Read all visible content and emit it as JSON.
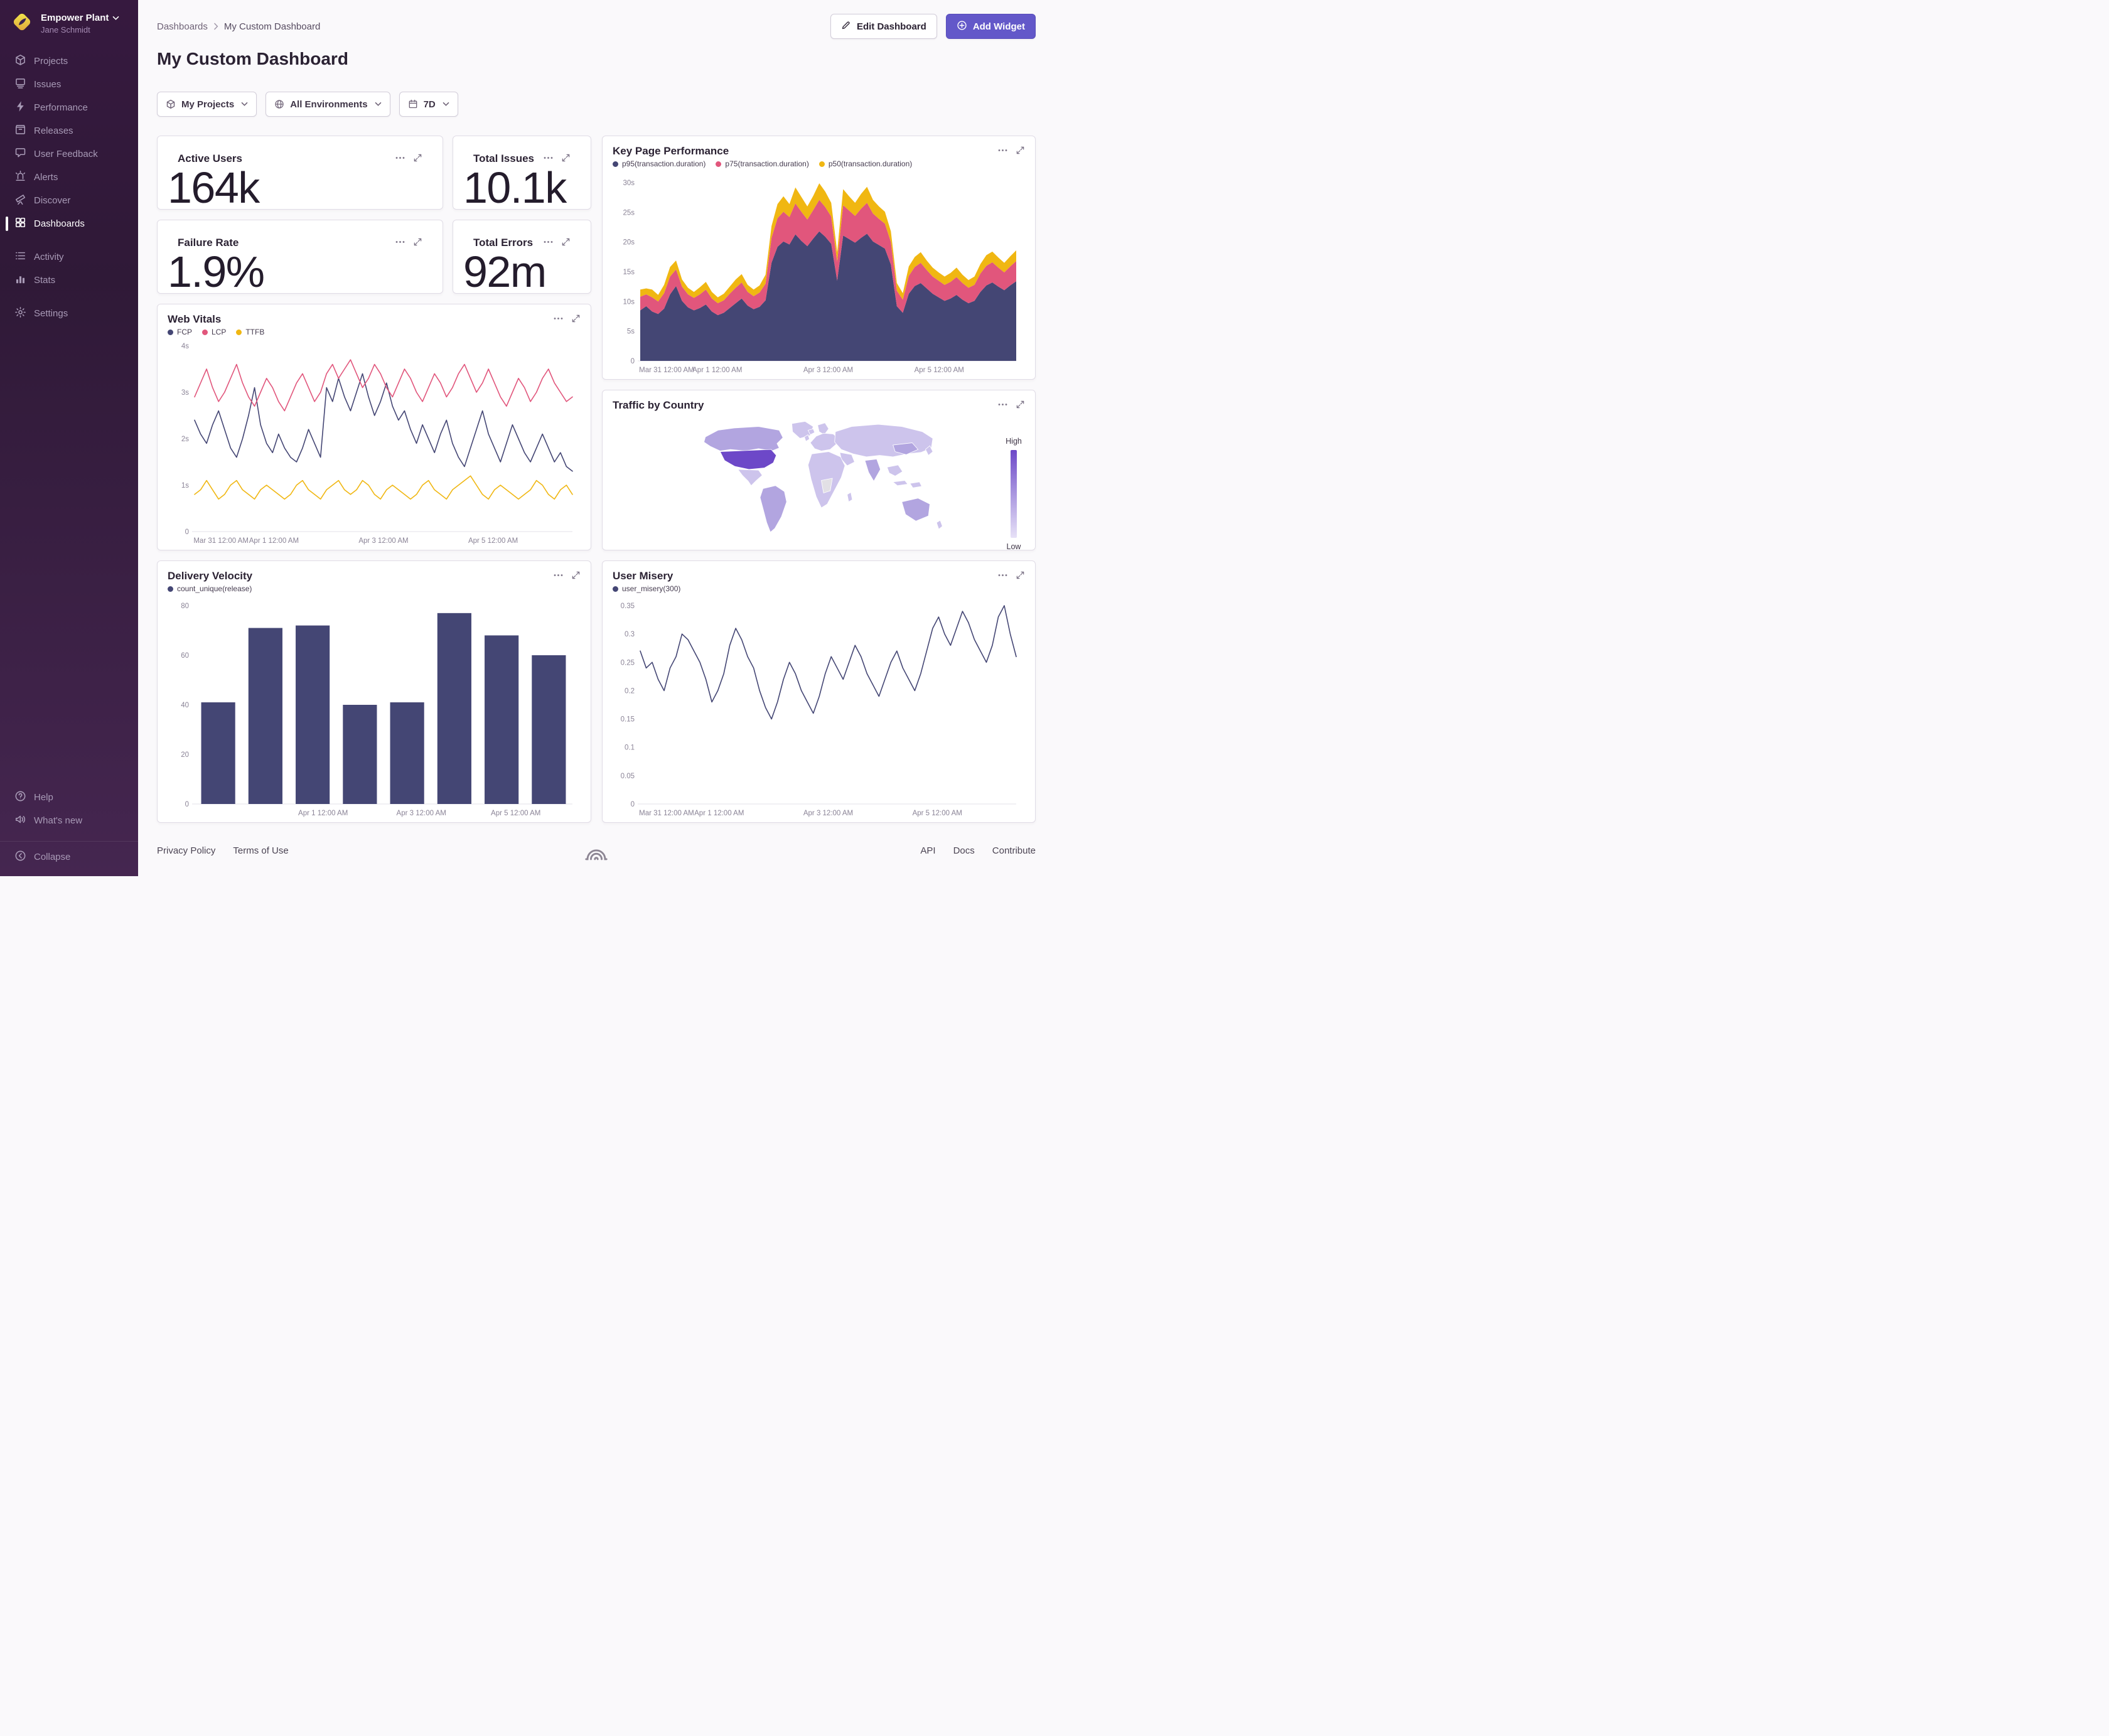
{
  "brand": {
    "accent_purple": "#6358C9",
    "sidebar_top": "#36193F",
    "sidebar_bottom": "#452650",
    "chart_navy": "#444674",
    "chart_pink": "#E1567C",
    "chart_yellow": "#F0B712",
    "map_high": "#6D48C8",
    "map_low": "#E7E1F7"
  },
  "sidebar": {
    "org_name": "Empower Plant",
    "user_name": "Jane Schmidt",
    "items": [
      {
        "label": "Projects"
      },
      {
        "label": "Issues"
      },
      {
        "label": "Performance"
      },
      {
        "label": "Releases"
      },
      {
        "label": "User Feedback"
      },
      {
        "label": "Alerts"
      },
      {
        "label": "Discover"
      },
      {
        "label": "Dashboards"
      },
      {
        "label": "Activity"
      },
      {
        "label": "Stats"
      },
      {
        "label": "Settings"
      }
    ],
    "footer_items": [
      {
        "label": "Help"
      },
      {
        "label": "What's new"
      },
      {
        "label": "Collapse"
      }
    ]
  },
  "breadcrumb": {
    "parent": "Dashboards",
    "current": "My Custom Dashboard"
  },
  "header": {
    "title": "My Custom Dashboard",
    "edit_button": "Edit Dashboard",
    "add_button": "Add Widget"
  },
  "filters": {
    "projects": "My Projects",
    "environments": "All Environments",
    "period": "7D"
  },
  "widgets": {
    "active_users": {
      "title": "Active Users",
      "value": "164k"
    },
    "total_issues": {
      "title": "Total Issues",
      "value": "10.1k"
    },
    "failure_rate": {
      "title": "Failure Rate",
      "value": "1.9%"
    },
    "total_errors": {
      "title": "Total Errors",
      "value": "92m"
    },
    "web_vitals": {
      "title": "Web Vitals"
    },
    "key_page_performance": {
      "title": "Key Page Performance"
    },
    "traffic_by_country": {
      "title": "Traffic by Country",
      "legend_high": "High",
      "legend_low": "Low",
      "highest_region": "United States"
    },
    "delivery_velocity": {
      "title": "Delivery Velocity"
    },
    "user_misery": {
      "title": "User Misery"
    }
  },
  "chart_data": {
    "key_page_performance": {
      "type": "stacked-area",
      "title": "Key Page Performance",
      "ylim": [
        0,
        30
      ],
      "yticks": [
        {
          "v": 0,
          "label": "0"
        },
        {
          "v": 5,
          "label": "5s"
        },
        {
          "v": 10,
          "label": "10s"
        },
        {
          "v": 15,
          "label": "15s"
        },
        {
          "v": 20,
          "label": "20s"
        },
        {
          "v": 25,
          "label": "25s"
        },
        {
          "v": 30,
          "label": "30s"
        }
      ],
      "xticks": [
        {
          "pos": 0.07,
          "label": "Mar 31 12:00 AM"
        },
        {
          "pos": 0.205,
          "label": "Apr 1 12:00 AM"
        },
        {
          "pos": 0.5,
          "label": "Apr 3 12:00 AM"
        },
        {
          "pos": 0.795,
          "label": "Apr 5 12:00 AM"
        }
      ],
      "series": [
        {
          "name": "p95(transaction.duration)",
          "color": "#444674",
          "values": [
            8.5,
            9.2,
            8.3,
            7.9,
            8.8,
            11.2,
            12.6,
            10.1,
            9.0,
            8.5,
            8.9,
            9.5,
            8.3,
            7.7,
            8.1,
            8.9,
            9.7,
            10.5,
            9.3,
            8.7,
            9.1,
            10.2,
            16.5,
            19.2,
            20.1,
            19.6,
            21.3,
            20.2,
            19.3,
            20.6,
            21.8,
            20.9,
            19.7,
            13.5,
            21.1,
            20.5,
            19.9,
            20.7,
            21.4,
            20.1,
            19.5,
            18.9,
            16.2,
            9.2,
            8.1,
            11.3,
            12.6,
            13.1,
            12.2,
            11.3,
            10.7,
            10.1,
            10.5,
            11.1,
            10.3,
            9.7,
            10.1,
            11.6,
            12.7,
            13.2,
            12.5,
            11.9,
            12.7,
            13.4
          ]
        },
        {
          "name": "p75(transaction.duration)",
          "color": "#E1567C",
          "values": [
            2.3,
            2.0,
            2.4,
            2.1,
            2.6,
            3.0,
            2.8,
            2.4,
            2.2,
            2.1,
            2.3,
            2.5,
            2.2,
            2.0,
            2.1,
            2.4,
            2.6,
            2.7,
            2.3,
            2.2,
            2.4,
            2.8,
            4.2,
            4.8,
            5.0,
            4.6,
            5.2,
            4.9,
            4.5,
            4.8,
            5.3,
            5.0,
            4.6,
            3.2,
            5.1,
            4.8,
            4.5,
            4.9,
            5.2,
            4.7,
            4.4,
            4.2,
            3.8,
            2.6,
            2.2,
            3.0,
            3.2,
            3.4,
            3.1,
            2.9,
            2.8,
            2.7,
            2.8,
            3.0,
            2.8,
            2.6,
            2.7,
            3.1,
            3.3,
            3.4,
            3.2,
            3.0,
            3.2,
            3.4
          ]
        },
        {
          "name": "p50(transaction.duration)",
          "color": "#F0B712",
          "values": [
            1.2,
            1.0,
            1.3,
            1.1,
            1.4,
            1.6,
            1.5,
            1.2,
            1.1,
            1.0,
            1.2,
            1.3,
            1.1,
            1.0,
            1.1,
            1.2,
            1.4,
            1.4,
            1.2,
            1.1,
            1.2,
            1.5,
            2.0,
            2.4,
            2.6,
            2.2,
            2.7,
            2.5,
            2.2,
            2.4,
            2.8,
            2.6,
            2.3,
            1.6,
            2.7,
            2.4,
            2.2,
            2.5,
            2.7,
            2.3,
            2.1,
            2.0,
            1.8,
            1.3,
            1.1,
            1.6,
            1.7,
            1.8,
            1.6,
            1.5,
            1.4,
            1.4,
            1.5,
            1.6,
            1.4,
            1.3,
            1.4,
            1.6,
            1.8,
            1.8,
            1.7,
            1.6,
            1.7,
            1.8
          ]
        }
      ]
    },
    "web_vitals": {
      "type": "line",
      "title": "Web Vitals",
      "ylim": [
        0,
        4
      ],
      "yticks": [
        {
          "v": 0,
          "label": "0"
        },
        {
          "v": 1,
          "label": "1s"
        },
        {
          "v": 2,
          "label": "2s"
        },
        {
          "v": 3,
          "label": "3s"
        },
        {
          "v": 4,
          "label": "4s"
        }
      ],
      "xticks": [
        {
          "pos": 0.07,
          "label": "Mar 31 12:00 AM"
        },
        {
          "pos": 0.21,
          "label": "Apr 1 12:00 AM"
        },
        {
          "pos": 0.5,
          "label": "Apr 3 12:00 AM"
        },
        {
          "pos": 0.79,
          "label": "Apr 5 12:00 AM"
        }
      ],
      "series": [
        {
          "name": "FCP",
          "color": "#444674",
          "values": [
            2.4,
            2.1,
            1.9,
            2.3,
            2.6,
            2.2,
            1.8,
            1.6,
            2.0,
            2.5,
            3.1,
            2.3,
            1.9,
            1.7,
            2.1,
            1.8,
            1.6,
            1.5,
            1.8,
            2.2,
            1.9,
            1.6,
            3.1,
            2.8,
            3.3,
            2.9,
            2.6,
            3.0,
            3.4,
            2.9,
            2.5,
            2.8,
            3.2,
            2.7,
            2.4,
            2.6,
            2.2,
            1.9,
            2.3,
            2.0,
            1.7,
            2.1,
            2.4,
            1.9,
            1.6,
            1.4,
            1.8,
            2.2,
            2.6,
            2.1,
            1.8,
            1.5,
            1.9,
            2.3,
            2.0,
            1.7,
            1.5,
            1.8,
            2.1,
            1.8,
            1.5,
            1.7,
            1.4,
            1.3
          ]
        },
        {
          "name": "LCP",
          "color": "#E1567C",
          "values": [
            2.9,
            3.2,
            3.5,
            3.1,
            2.8,
            3.0,
            3.3,
            3.6,
            3.2,
            2.9,
            2.7,
            3.0,
            3.3,
            3.1,
            2.8,
            2.6,
            2.9,
            3.2,
            3.4,
            3.1,
            2.8,
            3.0,
            3.4,
            3.6,
            3.3,
            3.5,
            3.7,
            3.4,
            3.1,
            3.3,
            3.6,
            3.4,
            3.1,
            2.9,
            3.2,
            3.5,
            3.3,
            3.0,
            2.8,
            3.1,
            3.4,
            3.2,
            2.9,
            3.1,
            3.4,
            3.6,
            3.3,
            3.0,
            3.2,
            3.5,
            3.2,
            2.9,
            2.7,
            3.0,
            3.3,
            3.1,
            2.8,
            3.0,
            3.3,
            3.5,
            3.2,
            3.0,
            2.8,
            2.9
          ]
        },
        {
          "name": "TTFB",
          "color": "#F0B712",
          "values": [
            0.8,
            0.9,
            1.1,
            0.9,
            0.7,
            0.8,
            1.0,
            1.1,
            0.9,
            0.8,
            0.7,
            0.9,
            1.0,
            0.9,
            0.8,
            0.7,
            0.8,
            1.0,
            1.1,
            0.9,
            0.8,
            0.7,
            0.9,
            1.0,
            1.1,
            0.9,
            0.8,
            0.9,
            1.1,
            1.0,
            0.8,
            0.7,
            0.9,
            1.0,
            0.9,
            0.8,
            0.7,
            0.8,
            1.0,
            1.1,
            0.9,
            0.8,
            0.7,
            0.9,
            1.0,
            1.1,
            1.2,
            1.0,
            0.8,
            0.7,
            0.9,
            1.0,
            0.9,
            0.8,
            0.7,
            0.8,
            0.9,
            1.1,
            1.0,
            0.8,
            0.7,
            0.9,
            1.0,
            0.8
          ]
        }
      ]
    },
    "delivery_velocity": {
      "type": "bar",
      "title": "Delivery Velocity",
      "series_name": "count_unique(release)",
      "color": "#444674",
      "values": [
        41,
        71,
        72,
        40,
        41,
        77,
        68,
        60
      ],
      "ylim": [
        0,
        80
      ],
      "yticks": [
        {
          "v": 0,
          "label": "0"
        },
        {
          "v": 20,
          "label": "20"
        },
        {
          "v": 40,
          "label": "40"
        },
        {
          "v": 60,
          "label": "60"
        },
        {
          "v": 80,
          "label": "80"
        }
      ],
      "xticks": [
        {
          "pos": 0.34,
          "label": "Apr 1 12:00 AM"
        },
        {
          "pos": 0.6,
          "label": "Apr 3 12:00 AM"
        },
        {
          "pos": 0.85,
          "label": "Apr 5 12:00 AM"
        }
      ]
    },
    "user_misery": {
      "type": "line",
      "title": "User Misery",
      "ylim": [
        0,
        0.35
      ],
      "yticks": [
        {
          "v": 0,
          "label": "0"
        },
        {
          "v": 0.05,
          "label": "0.05"
        },
        {
          "v": 0.1,
          "label": "0.1"
        },
        {
          "v": 0.15,
          "label": "0.15"
        },
        {
          "v": 0.2,
          "label": "0.2"
        },
        {
          "v": 0.25,
          "label": "0.25"
        },
        {
          "v": 0.3,
          "label": "0.3"
        },
        {
          "v": 0.35,
          "label": "0.35"
        }
      ],
      "xticks": [
        {
          "pos": 0.07,
          "label": "Mar 31 12:00 AM"
        },
        {
          "pos": 0.21,
          "label": "Apr 1 12:00 AM"
        },
        {
          "pos": 0.5,
          "label": "Apr 3 12:00 AM"
        },
        {
          "pos": 0.79,
          "label": "Apr 5 12:00 AM"
        }
      ],
      "series": [
        {
          "name": "user_misery(300)",
          "color": "#444674",
          "values": [
            0.27,
            0.24,
            0.25,
            0.22,
            0.2,
            0.24,
            0.26,
            0.3,
            0.29,
            0.27,
            0.25,
            0.22,
            0.18,
            0.2,
            0.23,
            0.28,
            0.31,
            0.29,
            0.26,
            0.24,
            0.2,
            0.17,
            0.15,
            0.18,
            0.22,
            0.25,
            0.23,
            0.2,
            0.18,
            0.16,
            0.19,
            0.23,
            0.26,
            0.24,
            0.22,
            0.25,
            0.28,
            0.26,
            0.23,
            0.21,
            0.19,
            0.22,
            0.25,
            0.27,
            0.24,
            0.22,
            0.2,
            0.23,
            0.27,
            0.31,
            0.33,
            0.3,
            0.28,
            0.31,
            0.34,
            0.32,
            0.29,
            0.27,
            0.25,
            0.28,
            0.33,
            0.35,
            0.3,
            0.26
          ]
        }
      ]
    }
  },
  "footer": {
    "privacy": "Privacy Policy",
    "terms": "Terms of Use",
    "api": "API",
    "docs": "Docs",
    "contribute": "Contribute"
  }
}
